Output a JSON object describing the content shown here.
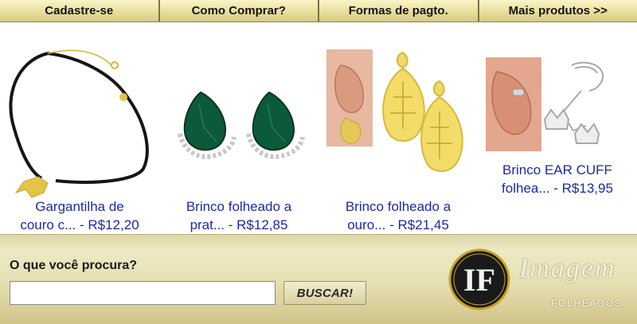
{
  "nav": {
    "items": [
      {
        "label": "Cadastre-se"
      },
      {
        "label": "Como Comprar?"
      },
      {
        "label": "Formas de pagto."
      },
      {
        "label": "Mais produtos >>"
      }
    ]
  },
  "products": [
    {
      "name": "Gargantilha de couro c...",
      "line1": "Gargantilha de",
      "line2": "couro c...",
      "price": " - R$12,20"
    },
    {
      "name": "Brinco folheado a prat...",
      "line1": "Brinco folheado a",
      "line2": "prat...",
      "price": " - R$12,85"
    },
    {
      "name": "Brinco folheado a ouro...",
      "line1": "Brinco folheado a",
      "line2": "ouro...",
      "price": " - R$21,45"
    },
    {
      "name": "Brinco EAR CUFF folhea...",
      "line1": "Brinco EAR CUFF",
      "line2": "folhea...",
      "price": " - R$13,95"
    }
  ],
  "search": {
    "label": "O que você procura?",
    "value": "",
    "button_label": "BUSCAR!"
  },
  "brand": {
    "monogram": "IF",
    "name": "Imagem",
    "tagline": "FOLHEADOS",
    "gold": "#c9a227",
    "link_color": "#1c2aa8"
  }
}
